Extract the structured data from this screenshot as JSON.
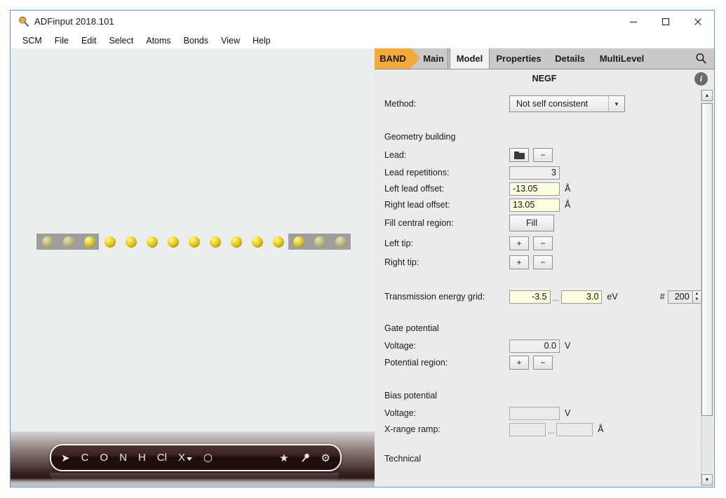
{
  "window": {
    "title": "ADFinput 2018.101",
    "app_icon": "magnifier-icon",
    "controls": {
      "minimize": "─",
      "maximize": "☐",
      "close": "✕"
    }
  },
  "menubar": {
    "items": [
      {
        "label": "SCM"
      },
      {
        "label": "File"
      },
      {
        "label": "Edit"
      },
      {
        "label": "Select"
      },
      {
        "label": "Atoms"
      },
      {
        "label": "Bonds"
      },
      {
        "label": "View"
      },
      {
        "label": "Help"
      }
    ]
  },
  "viewport": {
    "toolbar": {
      "items": [
        {
          "label": "➤",
          "name": "select-arrow-tool"
        },
        {
          "label": "C",
          "name": "carbon-tool"
        },
        {
          "label": "O",
          "name": "oxygen-tool"
        },
        {
          "label": "N",
          "name": "nitrogen-tool"
        },
        {
          "label": "H",
          "name": "hydrogen-tool"
        },
        {
          "label": "Cl",
          "name": "chlorine-tool"
        },
        {
          "label": "X",
          "name": "other-element-tool"
        },
        {
          "label": "⬡",
          "name": "ring-tool"
        },
        {
          "label": "★",
          "name": "favorites-tool"
        },
        {
          "label": "⚒",
          "name": "bond-tool"
        },
        {
          "label": "⚙",
          "name": "settings-tool"
        }
      ]
    },
    "structure": {
      "description": "linear gold atom chain with left and right lead regions",
      "left_lead_atoms": 3,
      "central_atoms": 9,
      "right_lead_atoms": 3
    }
  },
  "panel": {
    "tabs": [
      {
        "label": "BAND",
        "name": "tab-band",
        "selected": false
      },
      {
        "label": "Main",
        "name": "tab-main",
        "selected": false
      },
      {
        "label": "Model",
        "name": "tab-model",
        "selected": true
      },
      {
        "label": "Properties",
        "name": "tab-properties",
        "selected": false
      },
      {
        "label": "Details",
        "name": "tab-details",
        "selected": false
      },
      {
        "label": "MultiLevel",
        "name": "tab-multilevel",
        "selected": false
      }
    ],
    "search_icon": "search-icon",
    "title": "NEGF",
    "info_badge": "i",
    "method": {
      "label": "Method:",
      "value": "Not self consistent"
    },
    "geometry_building": {
      "heading": "Geometry building",
      "lead": {
        "label": "Lead:",
        "open_icon": "folder-icon",
        "remove_label": "−"
      },
      "lead_repetitions": {
        "label": "Lead repetitions:",
        "value": "3"
      },
      "left_lead_offset": {
        "label": "Left lead offset:",
        "value": "-13.05",
        "unit": "Å"
      },
      "right_lead_offset": {
        "label": "Right lead offset:",
        "value": "13.05",
        "unit": "Å"
      },
      "fill_central_region": {
        "label": "Fill central region:",
        "button": "Fill"
      },
      "left_tip": {
        "label": "Left tip:",
        "add": "+",
        "remove": "−"
      },
      "right_tip": {
        "label": "Right tip:",
        "add": "+",
        "remove": "−"
      }
    },
    "transmission": {
      "label": "Transmission energy grid:",
      "from": "-3.5",
      "separator": "...",
      "to": "3.0",
      "unit": "eV",
      "count_label": "#",
      "count": "200"
    },
    "gate_potential": {
      "heading": "Gate potential",
      "voltage": {
        "label": "Voltage:",
        "value": "0.0",
        "unit": "V"
      },
      "potential_region": {
        "label": "Potential region:",
        "add": "+",
        "remove": "−"
      }
    },
    "bias_potential": {
      "heading": "Bias potential",
      "voltage": {
        "label": "Voltage:",
        "value": "",
        "unit": "V"
      },
      "x_range_ramp": {
        "label": "X-range ramp:",
        "from": "",
        "separator": "...",
        "to": "",
        "unit": "Å"
      }
    },
    "technical": {
      "heading": "Technical"
    },
    "scrollbar": {
      "up": "▲",
      "down": "▼"
    }
  },
  "colors": {
    "accent_orange": "#f4a93c",
    "panel_bg": "#ebebeb",
    "tabbar_bg": "#c9c9c9",
    "field_yellow": "#fdfddf",
    "atom_gold": "#f0de54",
    "window_border": "#5a9bd5"
  }
}
